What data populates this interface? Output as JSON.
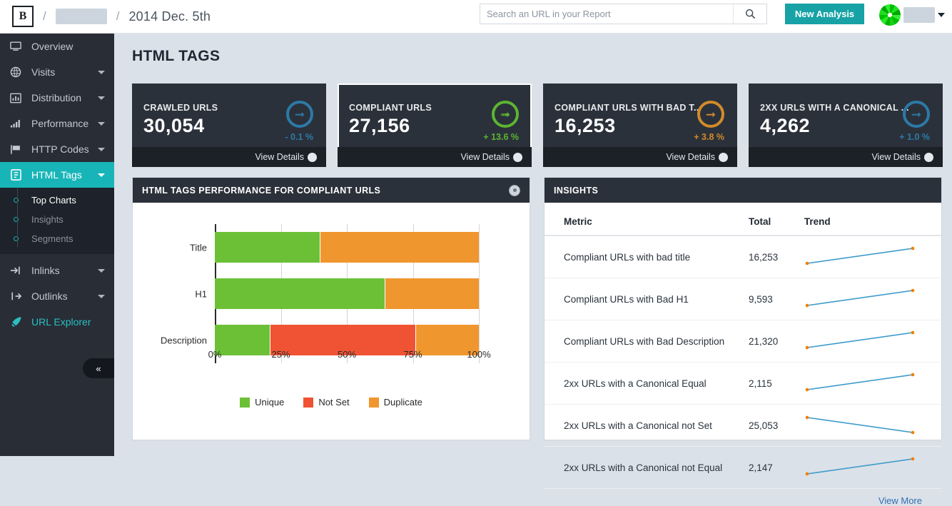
{
  "header": {
    "logo_text": "B",
    "separator": "/",
    "project_redacted": "",
    "date": "2014 Dec. 5th",
    "search": {
      "placeholder": "Search an URL in your Report",
      "value": "",
      "icon": "search-icon"
    },
    "new_analysis_label": "New Analysis",
    "avatar_icon": "user-avatar",
    "user_caret_icon": "chevron-down-icon"
  },
  "sidebar": {
    "items": [
      {
        "label": "Overview",
        "icon": "monitor-icon",
        "caret": false,
        "active": false
      },
      {
        "label": "Visits",
        "icon": "globe-icon",
        "caret": true,
        "active": false
      },
      {
        "label": "Distribution",
        "icon": "bar-chart-icon",
        "caret": true,
        "active": false
      },
      {
        "label": "Performance",
        "icon": "signal-icon",
        "caret": true,
        "active": false
      },
      {
        "label": "HTTP Codes",
        "icon": "flag-icon",
        "caret": true,
        "active": false
      },
      {
        "label": "HTML Tags",
        "icon": "html-tag-icon",
        "caret": true,
        "active": true
      }
    ],
    "sub_items": [
      {
        "label": "Top Charts",
        "current": true
      },
      {
        "label": "Insights",
        "current": false
      },
      {
        "label": "Segments",
        "current": false
      }
    ],
    "items_after": [
      {
        "label": "Inlinks",
        "icon": "arrow-into-icon",
        "caret": true,
        "highlight": false
      },
      {
        "label": "Outlinks",
        "icon": "arrow-out-icon",
        "caret": true,
        "highlight": false
      },
      {
        "label": "URL Explorer",
        "icon": "rocket-icon",
        "caret": false,
        "highlight": true
      }
    ],
    "collapse_icon": "chevrons-left-icon"
  },
  "main": {
    "page_title": "HTML TAGS",
    "cards": [
      {
        "label": "CRAWLED URLS",
        "value": "30,054",
        "delta": "- 0.1 %",
        "color": "#2c7aa8",
        "direction": "right",
        "footer": "View Details",
        "selected": false
      },
      {
        "label": "COMPLIANT URLS",
        "value": "27,156",
        "delta": "+ 13.6 %",
        "color": "#5cb531",
        "direction": "up",
        "footer": "View Details",
        "selected": true
      },
      {
        "label": "COMPLIANT URLS WITH BAD T...",
        "value": "16,253",
        "delta": "+ 3.8 %",
        "color": "#d18a2a",
        "direction": "right",
        "footer": "View Details",
        "selected": false
      },
      {
        "label": "2XX URLS WITH A CANONICAL ...",
        "value": "4,262",
        "delta": "+ 1.0 %",
        "color": "#2c7aa8",
        "direction": "right",
        "footer": "View Details",
        "selected": false
      }
    ],
    "chart_panel": {
      "title": "HTML TAGS PERFORMANCE FOR COMPLIANT URLS",
      "menu_icon": "options-dot-icon"
    },
    "insights_panel": {
      "title": "INSIGHTS",
      "columns": [
        "Metric",
        "Total",
        "Trend"
      ],
      "rows": [
        {
          "metric": "Compliant URLs with bad title",
          "total": "16,253",
          "trend": "up"
        },
        {
          "metric": "Compliant URLs with Bad H1",
          "total": "9,593",
          "trend": "up"
        },
        {
          "metric": "Compliant URLs with Bad Description",
          "total": "21,320",
          "trend": "up"
        },
        {
          "metric": "2xx URLs with a Canonical Equal",
          "total": "2,115",
          "trend": "up"
        },
        {
          "metric": "2xx URLs with a Canonical not Set",
          "total": "25,053",
          "trend": "down"
        },
        {
          "metric": "2xx URLs with a Canonical not Equal",
          "total": "2,147",
          "trend": "up"
        }
      ],
      "view_more_label": "View More",
      "trend_line_color": "#3d9ccc",
      "trend_point_color": "#f08000"
    }
  },
  "chart_data": {
    "type": "bar",
    "orientation": "horizontal",
    "stacked": true,
    "title": "HTML TAGS PERFORMANCE FOR COMPLIANT URLS",
    "xlabel": "",
    "ylabel": "",
    "xlim": [
      0,
      100
    ],
    "xticks": [
      "0%",
      "25%",
      "50%",
      "75%",
      "100%"
    ],
    "grid": true,
    "legend_position": "bottom",
    "categories": [
      "Title",
      "H1",
      "Description"
    ],
    "series": [
      {
        "name": "Unique",
        "color": "#6cc036",
        "values": [
          40.1,
          64.5,
          21.2
        ]
      },
      {
        "name": "Not Set",
        "color": "#ef5333",
        "values": [
          0,
          0,
          55.0
        ]
      },
      {
        "name": "Duplicate",
        "color": "#f0962e",
        "values": [
          59.9,
          35.5,
          23.8
        ]
      }
    ]
  }
}
